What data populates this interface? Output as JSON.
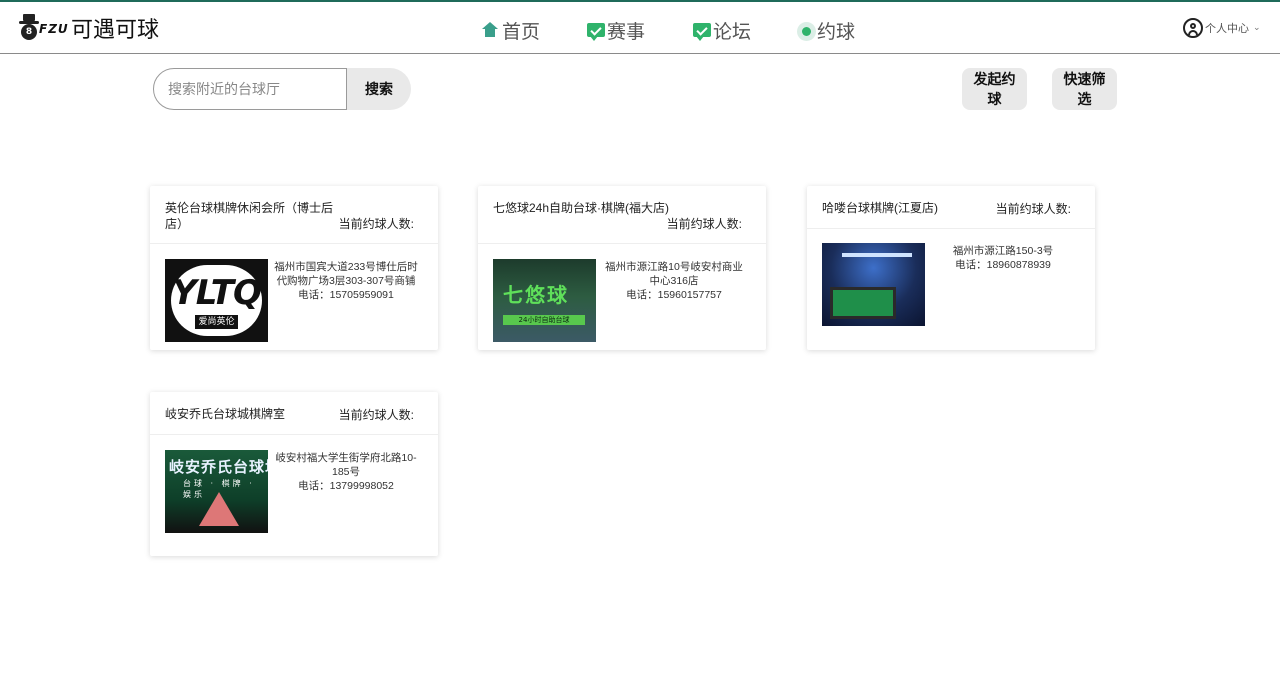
{
  "header": {
    "logo_badge": "FZU",
    "logo_text": "可遇可球",
    "nav": [
      {
        "label": "首页",
        "icon": "home-icon"
      },
      {
        "label": "赛事",
        "icon": "chat-icon"
      },
      {
        "label": "论坛",
        "icon": "chat-icon"
      },
      {
        "label": "约球",
        "icon": "circle-icon"
      }
    ],
    "user_center": "个人中心"
  },
  "search": {
    "placeholder": "搜索附近的台球厅",
    "button": "搜索"
  },
  "actions": {
    "start_label": "发起约球",
    "filter_label": "快速筛选"
  },
  "cards": [
    {
      "title": "英伦台球棋牌休闲会所（博士后店）",
      "count_label": "当前约球人数:",
      "address": "福州市国宾大道233号博仕后时代购物广场3层303-307号商铺",
      "phone": "电话：15705959091",
      "image_text": "YLTQ",
      "image_sub": "爱尚英伦"
    },
    {
      "title": "七悠球24h自助台球·棋牌(福大店)",
      "count_label": "当前约球人数:",
      "address": "福州市源江路10号岐安村商业中心316店",
      "phone": "电话：15960157757",
      "image_text": "七悠球",
      "image_sub": "24小时自助台球"
    },
    {
      "title": "哈喽台球棋牌(江夏店)",
      "count_label": "当前约球人数:",
      "address": "福州市源江路150-3号",
      "phone": "电话：18960878939"
    },
    {
      "title": "岐安乔氏台球城棋牌室",
      "count_label": "当前约球人数:",
      "address": "岐安村福大学生街学府北路10-185号",
      "phone": "电话：13799998052",
      "image_text": "岐安乔氏台球城",
      "image_sub": "台球 · 棋牌 · 娱乐"
    }
  ],
  "colors": {
    "accent": "#2fb36b",
    "home": "#3a9f8b",
    "topline": "#1f6b5a"
  }
}
